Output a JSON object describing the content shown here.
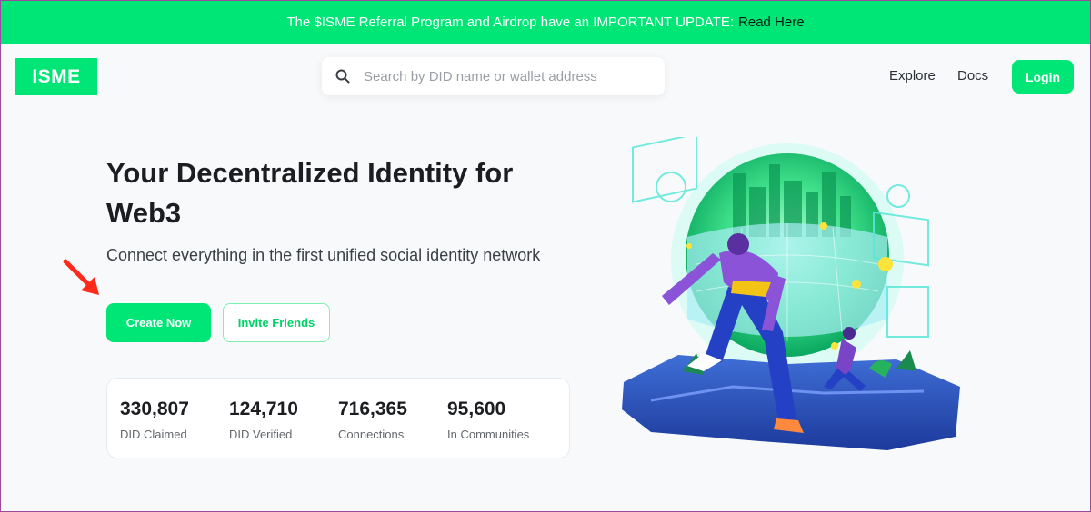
{
  "banner": {
    "text": "The $ISME Referral Program and Airdrop have an IMPORTANT UPDATE:",
    "link": "Read Here"
  },
  "header": {
    "logo": "ISME",
    "search_placeholder": "Search by DID name or wallet address",
    "nav": [
      "Explore",
      "Docs"
    ],
    "login": "Login"
  },
  "hero": {
    "title": "Your Decentralized Identity for Web3",
    "subtitle": "Connect everything in the first unified social identity network",
    "primary_button": "Create Now",
    "secondary_button": "Invite Friends"
  },
  "stats": [
    {
      "value": "330,807",
      "label": "DID Claimed"
    },
    {
      "value": "124,710",
      "label": "DID Verified"
    },
    {
      "value": "716,365",
      "label": "Connections"
    },
    {
      "value": "95,600",
      "label": "In Communities"
    }
  ],
  "colors": {
    "accent": "#00e676",
    "arrow": "#ff2a1a"
  },
  "icons": {
    "search": "search-icon",
    "arrow": "red-arrow-annotation"
  }
}
